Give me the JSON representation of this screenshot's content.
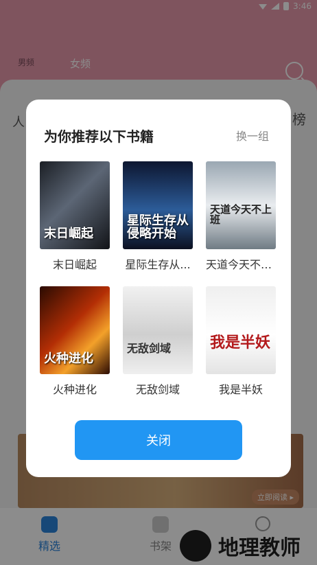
{
  "status": {
    "time": "3:46"
  },
  "header": {
    "tabs": [
      {
        "label": "男频"
      },
      {
        "label": "女频"
      }
    ]
  },
  "page": {
    "left_section_title": "人",
    "right_section_title": "榜",
    "banner_button": "立即阅读 ▸"
  },
  "dialog": {
    "title": "为你推荐以下书籍",
    "refresh_label": "换一组",
    "books": [
      {
        "title": "末日崛起",
        "cover_text": "末日崛起"
      },
      {
        "title": "星际生存从...",
        "cover_text": "星际生存从侵略开始"
      },
      {
        "title": "天道今天不上...",
        "cover_text": "天道今天不上班"
      },
      {
        "title": "火种进化",
        "cover_text": "火种进化"
      },
      {
        "title": "无敌剑域",
        "cover_text": "无敌剑域"
      },
      {
        "title": "我是半妖",
        "cover_text": "我是半妖"
      }
    ],
    "close_label": "关闭"
  },
  "bottom_nav": {
    "items": [
      {
        "label": "精选"
      },
      {
        "label": "书架"
      },
      {
        "label": ""
      }
    ]
  },
  "watermark": {
    "text": "地理教师"
  }
}
